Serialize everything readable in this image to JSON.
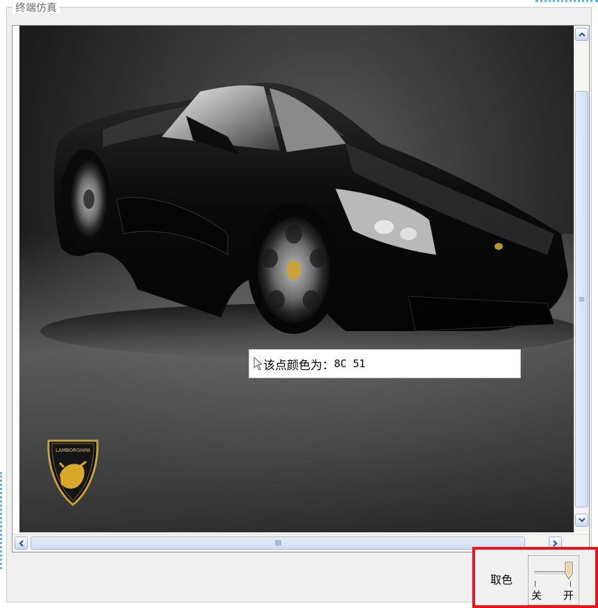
{
  "panel": {
    "title": "终端仿真"
  },
  "image": {
    "logo_text": "LAMBORGHINI"
  },
  "tooltip": {
    "label": "该点颜色为：",
    "value": "8C 51"
  },
  "scrollbars": {
    "vertical_grip": "≡",
    "horizontal_grip": "IIII"
  },
  "color_picker": {
    "label": "取色",
    "off_label": "关",
    "on_label": "开",
    "state": "on",
    "highlight_color": "#e8141c"
  }
}
